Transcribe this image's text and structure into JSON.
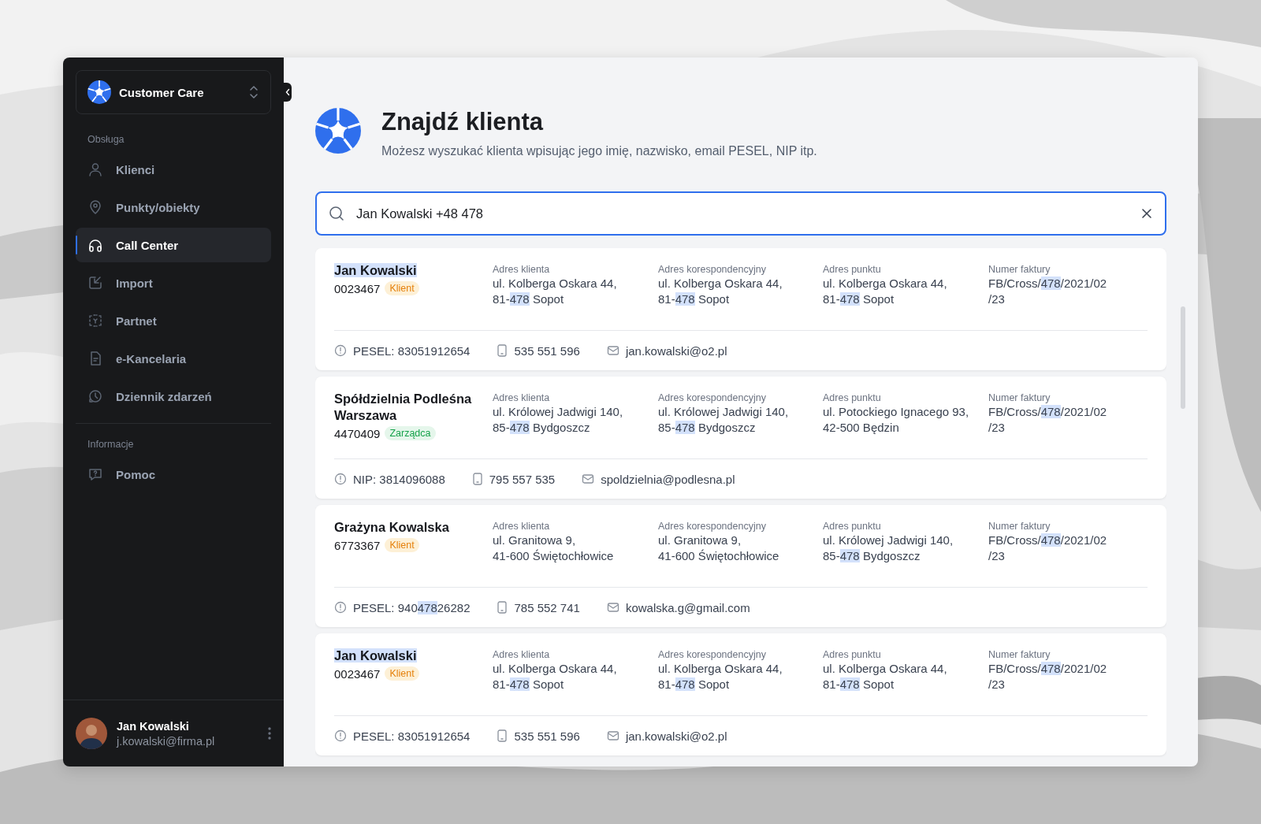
{
  "sidebar": {
    "workspace": {
      "name": "Customer Care"
    },
    "sections": [
      {
        "title": "Obsługa",
        "items": [
          {
            "label": "Klienci",
            "kind": "user",
            "selected": false
          },
          {
            "label": "Punkty/obiekty",
            "kind": "pin",
            "selected": false
          },
          {
            "label": "Call Center",
            "kind": "headset",
            "selected": true
          },
          {
            "label": "Import",
            "kind": "import",
            "selected": false
          },
          {
            "label": "Partnet",
            "kind": "partner",
            "selected": false
          },
          {
            "label": "e-Kancelaria",
            "kind": "document",
            "selected": false
          },
          {
            "label": "Dziennik zdarzeń",
            "kind": "history",
            "selected": false
          }
        ]
      },
      {
        "title": "Informacje",
        "items": [
          {
            "label": "Pomoc",
            "kind": "help",
            "selected": false
          }
        ]
      }
    ],
    "user": {
      "name": "Jan Kowalski",
      "email": "j.kowalski@firma.pl"
    }
  },
  "header": {
    "title": "Znajdź klienta",
    "subtitle": "Możesz wyszukać klienta wpisując jego imię, nazwisko, email PESEL, NIP itp."
  },
  "search": {
    "value": "Jan Kowalski +48 478 "
  },
  "results": [
    {
      "name": [
        {
          "text": "Jan Kowalski",
          "highlight": true
        }
      ],
      "number": "0023467",
      "badge": {
        "label": "Klient",
        "kind": "client"
      },
      "columns": [
        {
          "label": "Adres klienta",
          "lines": [
            [
              {
                "text": "ul. Kolberga Oskara 44,",
                "highlight": false
              }
            ],
            [
              {
                "text": "81-",
                "highlight": false
              },
              {
                "text": "478",
                "highlight": true
              },
              {
                "text": " Sopot",
                "highlight": false
              }
            ]
          ]
        },
        {
          "label": "Adres korespondencyjny",
          "lines": [
            [
              {
                "text": "ul. Kolberga Oskara 44,",
                "highlight": false
              }
            ],
            [
              {
                "text": "81-",
                "highlight": false
              },
              {
                "text": "478",
                "highlight": true
              },
              {
                "text": " Sopot",
                "highlight": false
              }
            ]
          ]
        },
        {
          "label": "Adres punktu",
          "lines": [
            [
              {
                "text": "ul. Kolberga Oskara 44,",
                "highlight": false
              }
            ],
            [
              {
                "text": "81-",
                "highlight": false
              },
              {
                "text": "478",
                "highlight": true
              },
              {
                "text": " Sopot",
                "highlight": false
              }
            ]
          ]
        },
        {
          "label": "Numer faktury",
          "lines": [
            [
              {
                "text": "FB/Cross/",
                "highlight": false
              },
              {
                "text": "478",
                "highlight": true
              },
              {
                "text": "/2021/02",
                "highlight": false
              }
            ],
            [
              {
                "text": "/23",
                "highlight": false
              }
            ]
          ]
        }
      ],
      "id_info": [
        {
          "text": "PESEL: 83051912654",
          "highlight": false
        }
      ],
      "phone": "535 551 596",
      "email": "jan.kowalski@o2.pl"
    },
    {
      "name": [
        {
          "text": "Spółdzielnia Podleśna Warszawa",
          "highlight": false
        }
      ],
      "number": "4470409",
      "badge": {
        "label": "Zarządca",
        "kind": "manager"
      },
      "columns": [
        {
          "label": "Adres klienta",
          "lines": [
            [
              {
                "text": "ul. Królowej Jadwigi 140,",
                "highlight": false
              }
            ],
            [
              {
                "text": "85-",
                "highlight": false
              },
              {
                "text": "478",
                "highlight": true
              },
              {
                "text": " Bydgoszcz",
                "highlight": false
              }
            ]
          ]
        },
        {
          "label": "Adres korespondencyjny",
          "lines": [
            [
              {
                "text": "ul. Królowej Jadwigi 140,",
                "highlight": false
              }
            ],
            [
              {
                "text": "85-",
                "highlight": false
              },
              {
                "text": "478",
                "highlight": true
              },
              {
                "text": " Bydgoszcz",
                "highlight": false
              }
            ]
          ]
        },
        {
          "label": "Adres punktu",
          "lines": [
            [
              {
                "text": "ul. Potockiego Ignacego 93,",
                "highlight": false
              }
            ],
            [
              {
                "text": "42-500 Będzin",
                "highlight": false
              }
            ]
          ]
        },
        {
          "label": "Numer faktury",
          "lines": [
            [
              {
                "text": "FB/Cross/",
                "highlight": false
              },
              {
                "text": "478",
                "highlight": true
              },
              {
                "text": "/2021/02",
                "highlight": false
              }
            ],
            [
              {
                "text": "/23",
                "highlight": false
              }
            ]
          ]
        }
      ],
      "id_info": [
        {
          "text": "NIP: 3814096088",
          "highlight": false
        }
      ],
      "phone": "795 557 535",
      "email": "spoldzielnia@podlesna.pl"
    },
    {
      "name": [
        {
          "text": "Grażyna Kowalska",
          "highlight": false
        }
      ],
      "number": "6773367",
      "badge": {
        "label": "Klient",
        "kind": "client"
      },
      "columns": [
        {
          "label": "Adres klienta",
          "lines": [
            [
              {
                "text": "ul. Granitowa 9,",
                "highlight": false
              }
            ],
            [
              {
                "text": "41-600 Świętochłowice",
                "highlight": false
              }
            ]
          ]
        },
        {
          "label": "Adres korespondencyjny",
          "lines": [
            [
              {
                "text": "ul. Granitowa 9,",
                "highlight": false
              }
            ],
            [
              {
                "text": "41-600 Świętochłowice",
                "highlight": false
              }
            ]
          ]
        },
        {
          "label": "Adres punktu",
          "lines": [
            [
              {
                "text": "ul. Królowej Jadwigi 140,",
                "highlight": false
              }
            ],
            [
              {
                "text": "85-",
                "highlight": false
              },
              {
                "text": "478",
                "highlight": true
              },
              {
                "text": " Bydgoszcz",
                "highlight": false
              }
            ]
          ]
        },
        {
          "label": "Numer faktury",
          "lines": [
            [
              {
                "text": "FB/Cross/",
                "highlight": false
              },
              {
                "text": "478",
                "highlight": true
              },
              {
                "text": "/2021/02",
                "highlight": false
              }
            ],
            [
              {
                "text": "/23",
                "highlight": false
              }
            ]
          ]
        }
      ],
      "id_info": [
        {
          "text": "PESEL: 940",
          "highlight": false
        },
        {
          "text": "478",
          "highlight": true
        },
        {
          "text": "26282",
          "highlight": false
        }
      ],
      "phone": "785 552 741",
      "email": "kowalska.g@gmail.com"
    },
    {
      "name": [
        {
          "text": "Jan Kowalski",
          "highlight": true
        }
      ],
      "number": "0023467",
      "badge": {
        "label": "Klient",
        "kind": "client"
      },
      "columns": [
        {
          "label": "Adres klienta",
          "lines": [
            [
              {
                "text": "ul. Kolberga Oskara 44,",
                "highlight": false
              }
            ],
            [
              {
                "text": "81-",
                "highlight": false
              },
              {
                "text": "478",
                "highlight": true
              },
              {
                "text": " Sopot",
                "highlight": false
              }
            ]
          ]
        },
        {
          "label": "Adres korespondencyjny",
          "lines": [
            [
              {
                "text": "ul. Kolberga Oskara 44,",
                "highlight": false
              }
            ],
            [
              {
                "text": "81-",
                "highlight": false
              },
              {
                "text": "478",
                "highlight": true
              },
              {
                "text": " Sopot",
                "highlight": false
              }
            ]
          ]
        },
        {
          "label": "Adres punktu",
          "lines": [
            [
              {
                "text": "ul. Kolberga Oskara 44,",
                "highlight": false
              }
            ],
            [
              {
                "text": "81-",
                "highlight": false
              },
              {
                "text": "478",
                "highlight": true
              },
              {
                "text": " Sopot",
                "highlight": false
              }
            ]
          ]
        },
        {
          "label": "Numer faktury",
          "lines": [
            [
              {
                "text": "FB/Cross/",
                "highlight": false
              },
              {
                "text": "478",
                "highlight": true
              },
              {
                "text": "/2021/02",
                "highlight": false
              }
            ],
            [
              {
                "text": "/23",
                "highlight": false
              }
            ]
          ]
        }
      ],
      "id_info": [
        {
          "text": "PESEL: 83051912654",
          "highlight": false
        }
      ],
      "phone": "535 551 596",
      "email": "jan.kowalski@o2.pl"
    }
  ]
}
